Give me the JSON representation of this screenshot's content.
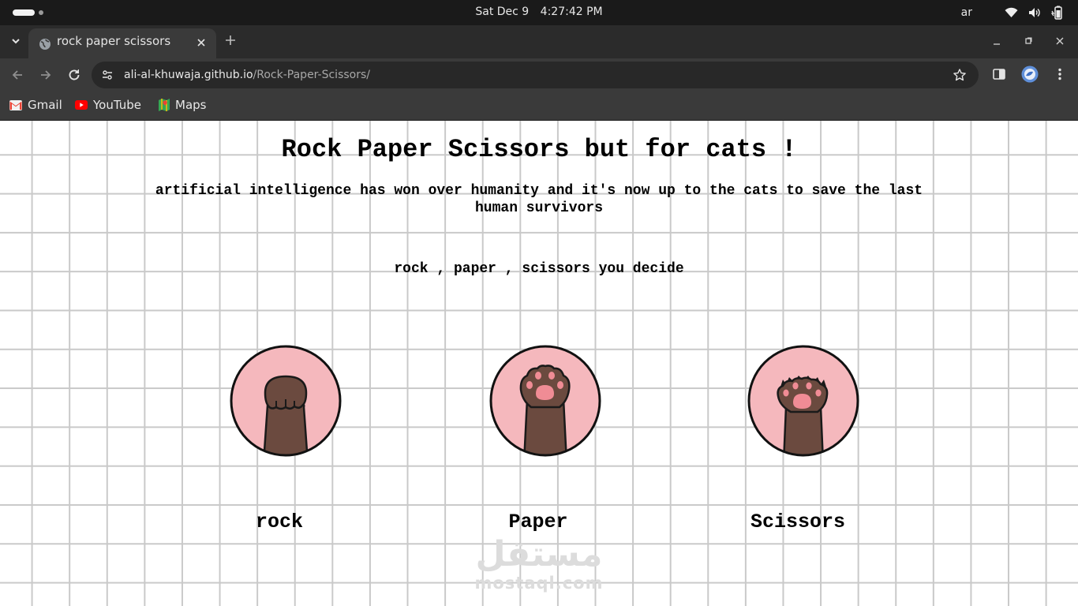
{
  "os": {
    "date": "Sat Dec 9",
    "time": "4:27:42 PM",
    "language": "ar"
  },
  "browser": {
    "tab_title": "rock paper scissors",
    "url_host": "ali-al-khuwaja.github.io",
    "url_path": "/Rock-Paper-Scissors/",
    "bookmarks": [
      {
        "label": "Gmail",
        "icon": "gmail-icon"
      },
      {
        "label": "YouTube",
        "icon": "youtube-icon"
      },
      {
        "label": "Maps",
        "icon": "maps-icon"
      }
    ]
  },
  "page": {
    "title": "Rock Paper Scissors but for cats !",
    "subtitle": "artificial intelligence has won over humanity and it's now up to the cats to save the last human survivors",
    "prompt": "rock , paper , scissors you decide",
    "choices": [
      {
        "label": "rock",
        "icon": "cat-paw-fist-icon"
      },
      {
        "label": "Paper",
        "icon": "cat-paw-open-icon"
      },
      {
        "label": "Scissors",
        "icon": "cat-paw-claws-icon"
      }
    ]
  },
  "watermark": {
    "arabic": "مستقل",
    "latin": "mostaql.com"
  },
  "colors": {
    "circle_fill": "#f5b8bd",
    "paw": "#6b4a3f",
    "pad": "#f08c95",
    "grid": "#c9c9c9"
  }
}
